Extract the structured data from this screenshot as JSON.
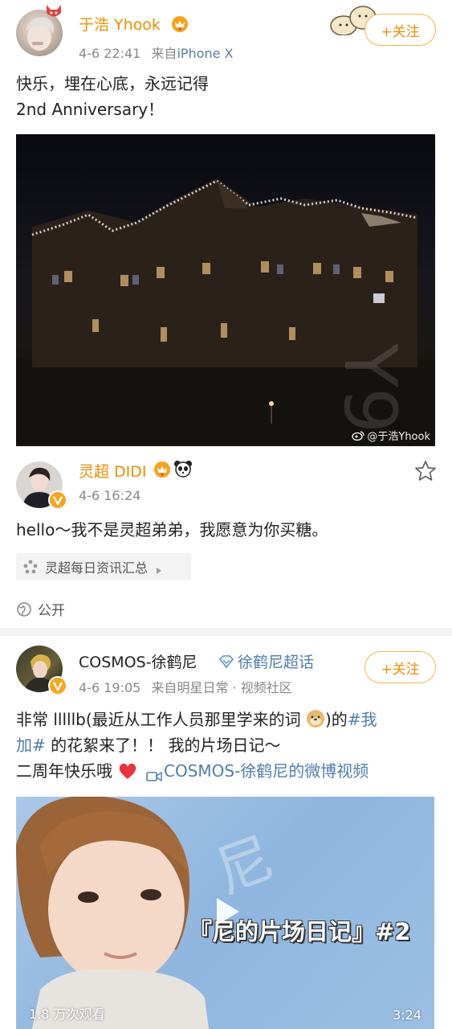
{
  "post1": {
    "user_name": "于浩 Yhook",
    "timestamp": "4-6 22:41",
    "source_prefix": "来自",
    "source": "iPhone X",
    "follow_label": "+关注",
    "text_line1": "快乐，埋在心底，永远记得",
    "text_line2": "2nd Anniversary！",
    "image_watermark": "@于浩Yhook",
    "vip_badge_icon": "vip-crown-icon"
  },
  "comment": {
    "user_name": "灵超 DIDI",
    "timestamp": "4-6 16:24",
    "text": "hello～我不是灵超弟弟，我愿意为你买糖。",
    "topic_chip": "灵超每日资讯汇总",
    "visibility": "公开",
    "star_icon": "star-outline-icon"
  },
  "post2": {
    "user_name": "COSMOS-徐鹤尼",
    "supertopic": "徐鹤尼超话",
    "timestamp": "4-6 19:05",
    "source_prefix": "来自",
    "source": "明星日常 · 视频社区",
    "follow_label": "+关注",
    "text_line1_a": "非常 lllllb(最近从工作人员那里学来的词",
    "text_line1_b": ")的",
    "hashtag_part1": "#我",
    "hashtag_part2": "加#",
    "text_line2_rest": " 的花絮来了！！ 我的片场日记～",
    "text_line3": "二周年快乐哦",
    "video_link": "COSMOS-徐鹤尼的微博视频",
    "video_title": "『尼的片场日记』#2",
    "video_views": "1.8 万次观看",
    "video_duration": "3:24"
  },
  "colors": {
    "accent_orange": "#f08c00",
    "link_blue": "#4f7cae",
    "heart_red": "#e8323c"
  }
}
